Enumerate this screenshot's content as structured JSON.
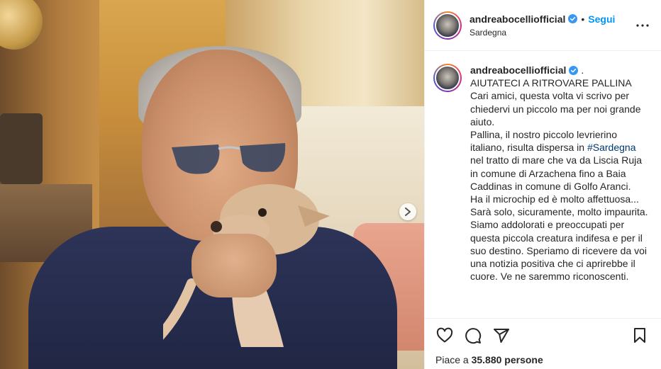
{
  "post": {
    "username": "andreabocelliofficial",
    "follow_label": "Segui",
    "separator": "•",
    "location": "Sardegna",
    "caption_suffix": ".",
    "caption_title": "AIUTATECI A RITROVARE PALLINA",
    "caption_part1": "Cari amici, questa volta vi scrivo per chiedervi un piccolo ma per noi grande aiuto.\nPallina, il nostro piccolo levrierino italiano, risulta dispersa in ",
    "hashtag": "#Sardegna",
    "caption_part2": "\nnel tratto di mare che va da Liscia Ruja in comune di Arzachena fino a Baia Caddinas in comune di Golfo Aranci.\nHa il microchip ed è molto affettuosa...\nSarà solo, sicuramente, molto impaurita.\nSiamo addolorati e preoccupati per questa piccola creatura indifesa e per il suo destino. Speriamo di ricevere da voi una notizia positiva che ci aprirebbe il cuore. Ve ne saremmo riconoscenti.",
    "likes_prefix": "Piace a ",
    "likes_count": "35.880",
    "likes_suffix": " persone"
  },
  "icons": {
    "verified": "verified-badge-icon",
    "more": "more-options-icon",
    "like": "heart-icon",
    "comment": "comment-icon",
    "share": "share-icon",
    "save": "bookmark-icon",
    "next": "chevron-right-icon"
  },
  "colors": {
    "accent": "#0095f6",
    "hashtag": "#00376b",
    "text": "#262626",
    "divider": "#efefef"
  }
}
